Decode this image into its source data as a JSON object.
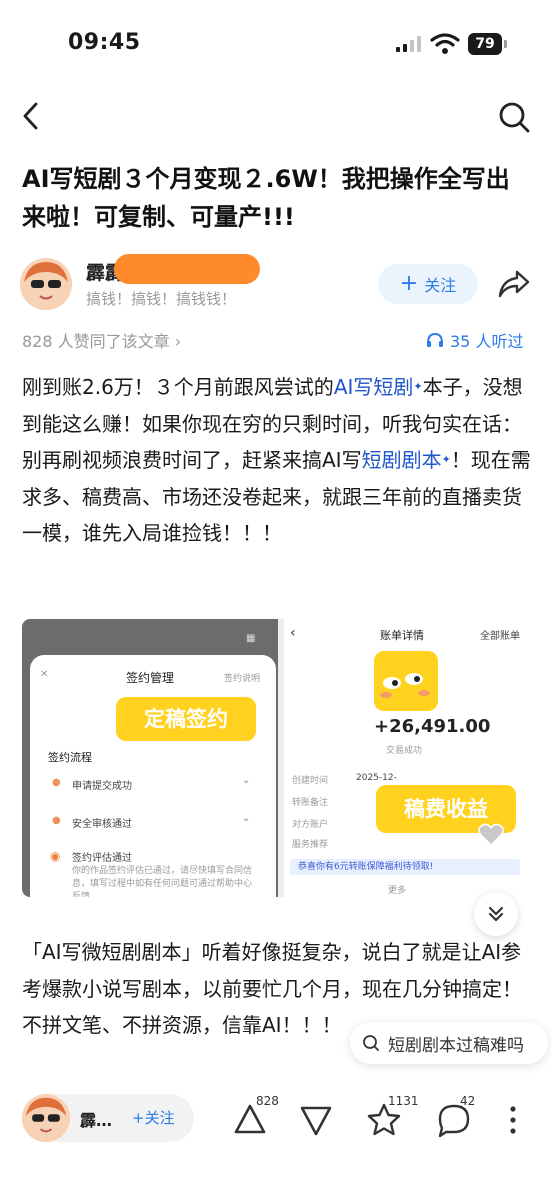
{
  "status_bar": {
    "time": "09:45",
    "battery": "79"
  },
  "article": {
    "title": "AI写短剧３个月变现２.6W！我把操作全写出来啦！可复制、可量产!!!",
    "author": {
      "name": "霹霹",
      "bio": "搞钱！搞钱！搞钱钱！"
    },
    "follow_label": "关注",
    "likes_text": "828 人赞同了该文章 ›",
    "listen_text": "35 人听过",
    "para1": {
      "t1": "刚到账2.6万！３个月前跟风尝试的",
      "link1": "AI写短剧",
      "t2": "本子，没想到能这么赚！如果你现在穷的只剩时间，听我句实在话：别再刷视频浪费时间了，赶紧来搞AI写",
      "link2": "短剧剧本",
      "t3": "！现在需求多、稿费高、市场还没卷起来，就跟三年前的直播卖货一模，谁先入局谁捡钱！！！"
    },
    "para2": "「AI写微短剧剧本」听着好像挺复杂，说白了就是让AI参考爆款小说写剧本，以前要忙几个月，现在几分钟搞定！不拼文笔、不拼资源，信靠AI！！！"
  },
  "image_left": {
    "header": "签约管理",
    "header_right": "签约说明",
    "tag": "定稿签约",
    "section": "签约流程",
    "steps": [
      "申请提交成功",
      "安全审核通过",
      "签约评估通过"
    ],
    "note": "你的作品签约评估已通过，请尽快填写合同信息，填写过程中如有任何问题可通过帮助中心反馈"
  },
  "image_right": {
    "header": "账单详情",
    "header_right": "全部账单",
    "amount": "+26,491.00",
    "status": "交易成功",
    "rows": [
      "创建时间",
      "转账备注",
      "对方账户",
      "服务推荐"
    ],
    "date": "2025-12-",
    "tag": "稿费收益",
    "banner": "恭喜你有6元转账保障福利待领取!",
    "more": "更多"
  },
  "search_suggest": "短剧剧本过稿难吗",
  "bottom_bar": {
    "name": "霹…",
    "follow": "+关注",
    "upvotes": "828",
    "favorites": "1131",
    "comments": "42"
  },
  "colors": {
    "accent": "#2b7bea",
    "link": "#1f56c9",
    "redact": "#ff8a2c",
    "tag_yellow": "#ffd21f"
  }
}
